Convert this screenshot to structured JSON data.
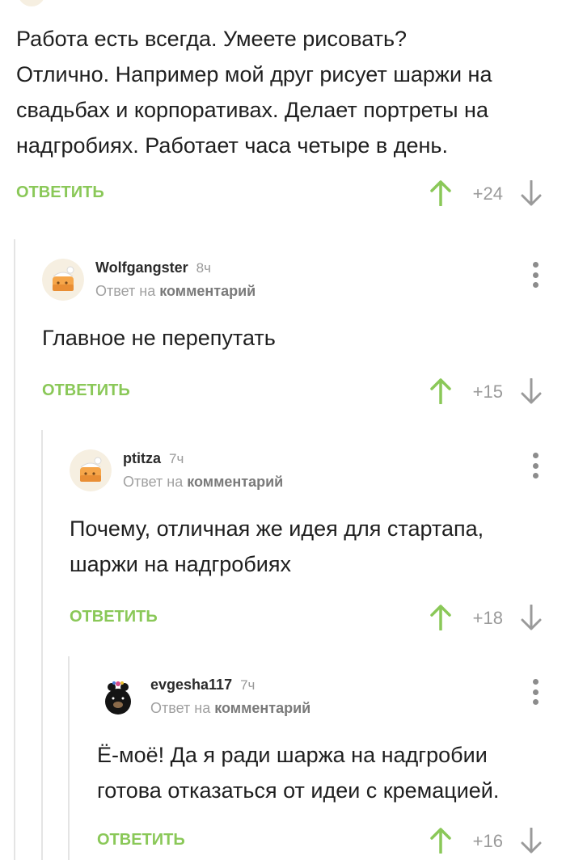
{
  "top_comment": {
    "lines": [
      "Работа есть всегда. Умеете рисовать?",
      "Отлично. Например мой друг рисует шаржи на",
      "свадьбах и корпоративах. Делает портреты на",
      "надгробиях. Работает часа четыре в день."
    ],
    "reply_label": "ОТВЕТИТЬ",
    "rating": "+24"
  },
  "comments": [
    {
      "username": "Wolfgangster",
      "time": "8ч",
      "reply_prefix": "Ответ на",
      "reply_link": "комментарий",
      "lines": [
        "Главное не перепутать"
      ],
      "reply_label": "ОТВЕТИТЬ",
      "rating": "+15",
      "avatar_icon": "default-cake-avatar-icon"
    },
    {
      "username": "ptitza",
      "time": "7ч",
      "reply_prefix": "Ответ на",
      "reply_link": "комментарий",
      "lines": [
        "Почему, отличная же идея для стартапа,",
        "шаржи на надгробиях"
      ],
      "reply_label": "ОТВЕТИТЬ",
      "rating": "+18",
      "avatar_icon": "default-cake-avatar-icon"
    },
    {
      "username": "evgesha117",
      "time": "7ч",
      "reply_prefix": "Ответ на",
      "reply_link": "комментарий",
      "lines": [
        "Ё-моё! Да я ради шаржа на надгробии",
        "готова отказаться от идеи с кремацией."
      ],
      "reply_label": "ОТВЕТИТЬ",
      "rating": "+16",
      "avatar_icon": "black-bear-avatar-icon"
    }
  ],
  "icons": {
    "upvote": "arrow-up-icon",
    "downvote": "arrow-down-icon",
    "more": "more-vertical-icon"
  },
  "colors": {
    "accent_green": "#8ac858",
    "rating_gray": "#9a9a9a",
    "thread_line": "#e4e4e4"
  }
}
